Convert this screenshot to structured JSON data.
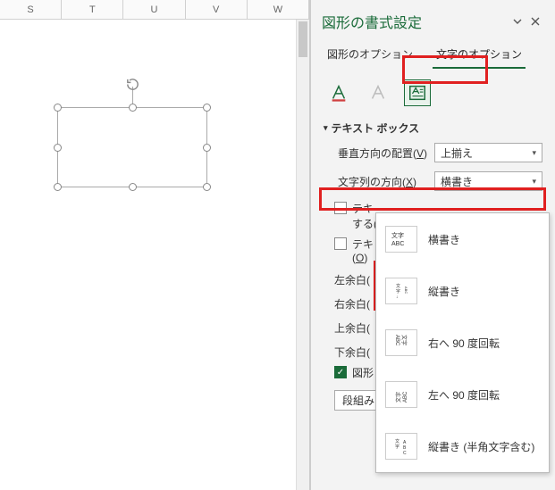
{
  "cols": [
    "S",
    "T",
    "U",
    "V",
    "W"
  ],
  "pane": {
    "title": "図形の書式設定",
    "tabs": {
      "shape": "図形のオプション",
      "text": "文字のオプション"
    }
  },
  "section": {
    "textbox": "テキスト ボックス"
  },
  "fields": {
    "valign_label": "垂直方向の配置(",
    "valign_key": "V",
    "valign_value": "上揃え",
    "dir_label": "文字列の方向(",
    "dir_key": "X",
    "dir_value": "横書き"
  },
  "checks": {
    "autofit_none_a": "テキ",
    "autofit_none_b": "する(",
    "autofit_shrink_a": "テキ",
    "autofit_shrink_b": "(",
    "autofit_shrink_key": "O",
    "shape_text_wrap": "図形"
  },
  "margins": {
    "left": "左余白(",
    "right": "右余白(",
    "top": "上余白(",
    "bottom": "下余白("
  },
  "columns_btn": "段組み",
  "dd": {
    "horizontal": "横書き",
    "vertical": "縦書き",
    "rot_right": "右へ 90 度回転",
    "rot_left": "左へ 90 度回転",
    "vertical_half": "縦書き (半角文字含む)"
  }
}
